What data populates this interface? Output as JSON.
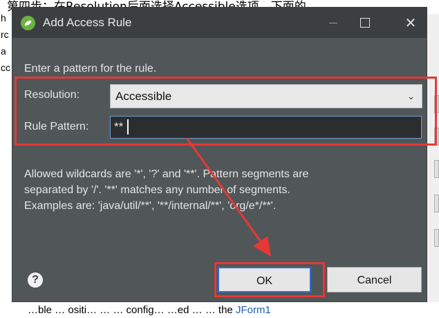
{
  "background": {
    "caption": "第四步：在Resolution后面选择Accessible选项，下面的",
    "left_fragments": [
      "h",
      "rc",
      "a",
      "cc"
    ],
    "bottom_text": "…ble … ositi… … … config… …ed … … the ",
    "bottom_link": "JForm1"
  },
  "dialog": {
    "title": "Add Access Rule",
    "window_controls": {
      "minimize": "—",
      "maximize": "☐",
      "close": "✕"
    },
    "description": "Enter a pattern for the rule.",
    "resolution": {
      "label": "Resolution:",
      "value": "Accessible"
    },
    "pattern": {
      "label": "Rule Pattern:",
      "value": "**"
    },
    "help_lines": [
      "Allowed wildcards are '*', '?' and '**'. Pattern segments are",
      "separated by '/'. '**' matches any number of segments.",
      "Examples are: 'java/util/**', '**/internal/**', 'org/e*/**'."
    ],
    "help_icon_glyph": "?",
    "ok_label": "OK",
    "cancel_label": "Cancel"
  },
  "colors": {
    "annotation_red": "#e53935",
    "dialog_bg": "#515658",
    "titlebar_bg": "#3c3f41",
    "focus_blue": "#2f6fd6"
  }
}
